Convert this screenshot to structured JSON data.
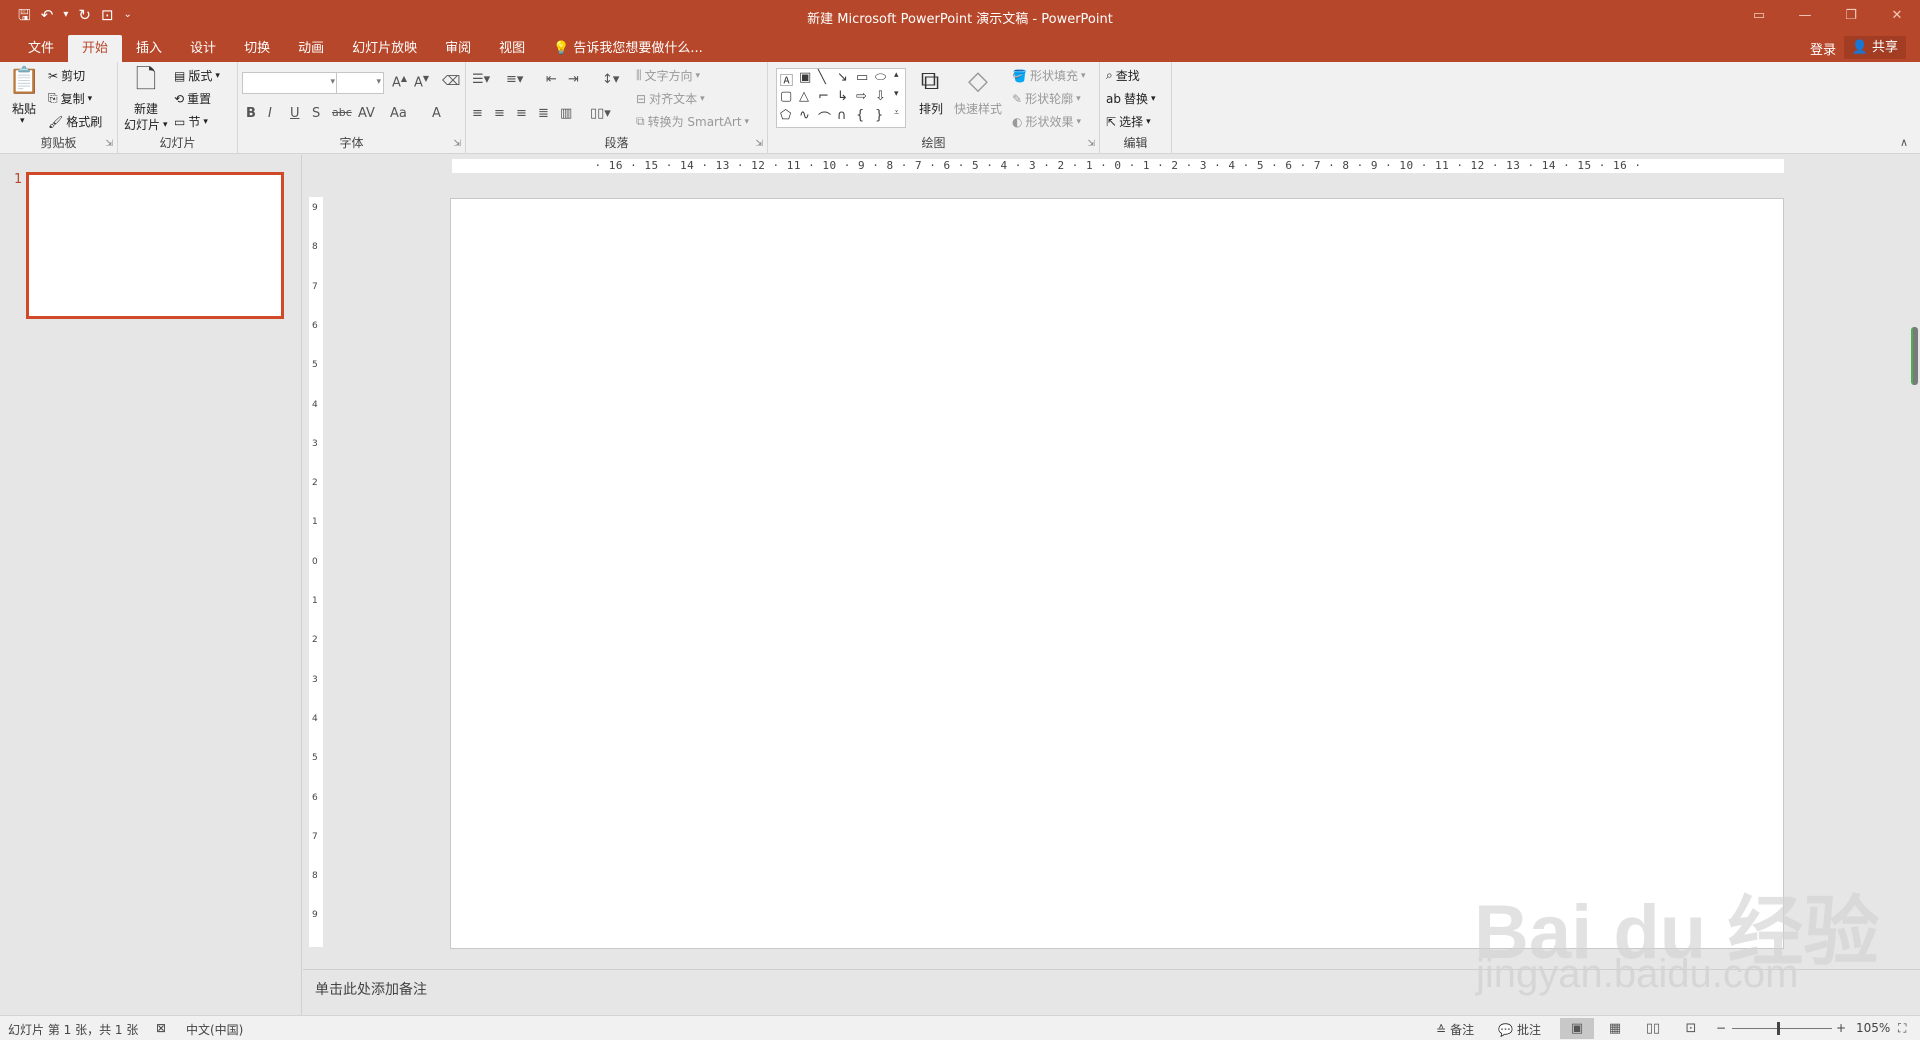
{
  "titlebar": {
    "title": "新建 Microsoft PowerPoint 演示文稿 - PowerPoint",
    "qat_icons": [
      "save-icon",
      "undo-icon",
      "redo-icon",
      "start-from-beginning-icon",
      "customize-icon"
    ]
  },
  "tabs": [
    "文件",
    "开始",
    "插入",
    "设计",
    "切换",
    "动画",
    "幻灯片放映",
    "审阅",
    "视图"
  ],
  "active_tab": "开始",
  "tell_me": "告诉我您想要做什么...",
  "account": {
    "login": "登录",
    "share": "共享"
  },
  "ribbon": {
    "clipboard": {
      "label": "剪贴板",
      "paste": "粘贴",
      "cut": "剪切",
      "copy": "复制",
      "format_painter": "格式刷"
    },
    "slides": {
      "label": "幻灯片",
      "new_slide_1": "新建",
      "new_slide_2": "幻灯片",
      "layout": "版式",
      "reset": "重置",
      "section": "节"
    },
    "font": {
      "label": "字体",
      "font_name": "",
      "font_size": "",
      "buttons": [
        "B",
        "I",
        "U",
        "S",
        "abc",
        "AV",
        "Aa",
        "A"
      ]
    },
    "paragraph": {
      "label": "段落",
      "text_direction": "文字方向",
      "align_text": "对齐文本",
      "smartart": "转换为 SmartArt"
    },
    "drawing": {
      "label": "绘图",
      "arrange": "排列",
      "quick_styles": "快速样式",
      "shape_fill": "形状填充",
      "shape_outline": "形状轮廓",
      "shape_effects": "形状效果"
    },
    "editing": {
      "label": "编辑",
      "find": "查找",
      "replace": "替换",
      "select": "选择"
    }
  },
  "thumbnails": [
    {
      "number": "1"
    }
  ],
  "hruler": "· 16 · 15 · 14 · 13 · 12 · 11 · 10 · 9 · 8 · 7 · 6 · 5 · 4 · 3 · 2 · 1 · 0 · 1 · 2 · 3 · 4 · 5 · 6 · 7 · 8 · 9 · 10 · 11 · 12 · 13 · 14 · 15 · 16 ·",
  "vruler": [
    "9",
    "8",
    "7",
    "6",
    "5",
    "4",
    "3",
    "2",
    "1",
    "0",
    "1",
    "2",
    "3",
    "4",
    "5",
    "6",
    "7",
    "8",
    "9"
  ],
  "notes_placeholder": "单击此处添加备注",
  "statusbar": {
    "slide_info": "幻灯片 第 1 张，共 1 张",
    "language": "中文(中国)",
    "notes": "备注",
    "comments": "批注",
    "zoom": "105%"
  },
  "watermark": {
    "line1": "Bai du 经验",
    "line2": "jingyan.baidu.com"
  },
  "colors": {
    "accent": "#b7472a",
    "selection": "#d04a2a"
  }
}
